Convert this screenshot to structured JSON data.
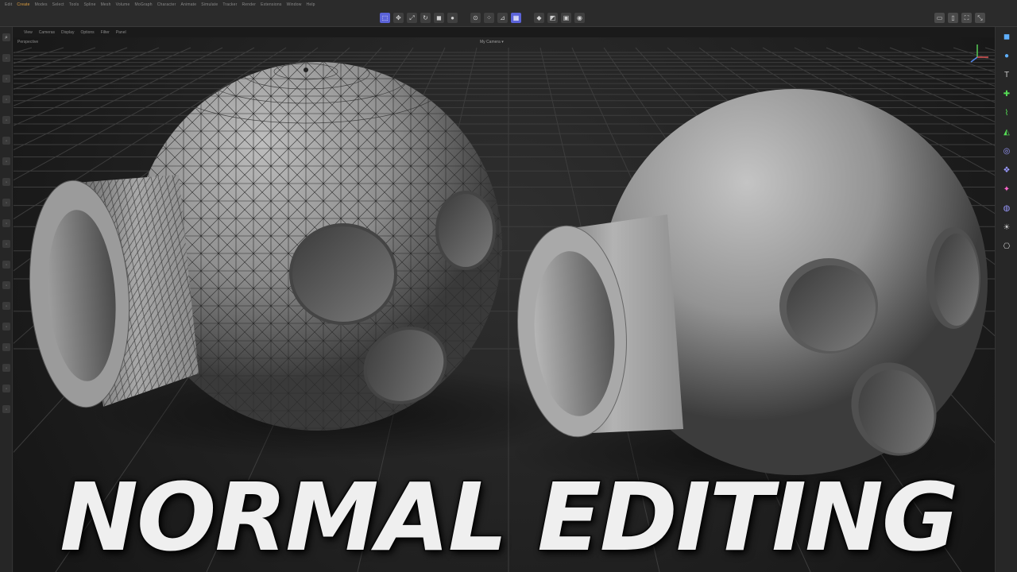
{
  "menubar": {
    "items": [
      "Edit",
      "Create",
      "Modes",
      "Select",
      "Tools",
      "Spline",
      "Mesh",
      "Volume",
      "MoGraph",
      "Character",
      "Animate",
      "Simulate",
      "Tracker",
      "Render",
      "Extensions",
      "Window",
      "Help"
    ],
    "active_index": 1
  },
  "toolbar": {
    "icons": [
      "select-icon",
      "move-icon",
      "scale-icon",
      "rotate-icon",
      "cube-icon",
      "sphere-icon",
      "snap-icon",
      "points-icon",
      "edges-icon",
      "polygons-icon",
      "model-icon",
      "uv-icon",
      "texture-icon",
      "render-icon"
    ],
    "selected": [
      "select-icon",
      "polygons-icon"
    ]
  },
  "toolbar_right": {
    "icons": [
      "layout-icon",
      "layout-alt-icon",
      "fullscreen-icon",
      "expand-icon"
    ]
  },
  "viewport": {
    "menu": [
      "View",
      "Cameras",
      "Display",
      "Options",
      "Filter",
      "Panel"
    ],
    "label": "Perspective",
    "camera": "My Camera ▾"
  },
  "right_tools": {
    "icons": [
      "cube-icon",
      "sphere-icon",
      "text-icon",
      "generator-icon",
      "spline-icon",
      "deformer-icon",
      "field-icon",
      "mograph-icon",
      "effector-icon",
      "volume-icon",
      "light-icon",
      "camera-icon"
    ],
    "colors": [
      "#5fb0ff",
      "#5fb0ff",
      "#cccccc",
      "#55dd55",
      "#55dd55",
      "#55dd55",
      "#9a9aff",
      "#9a9aff",
      "#ff66cc",
      "#9a9aff",
      "#cccccc",
      "#cccccc"
    ]
  },
  "title": "NORMAL EDITING",
  "colors": {
    "accent": "#5b63d8",
    "active_menu": "#e0a040",
    "grid": "#3a3a3a",
    "background": "#1f1f1f"
  }
}
